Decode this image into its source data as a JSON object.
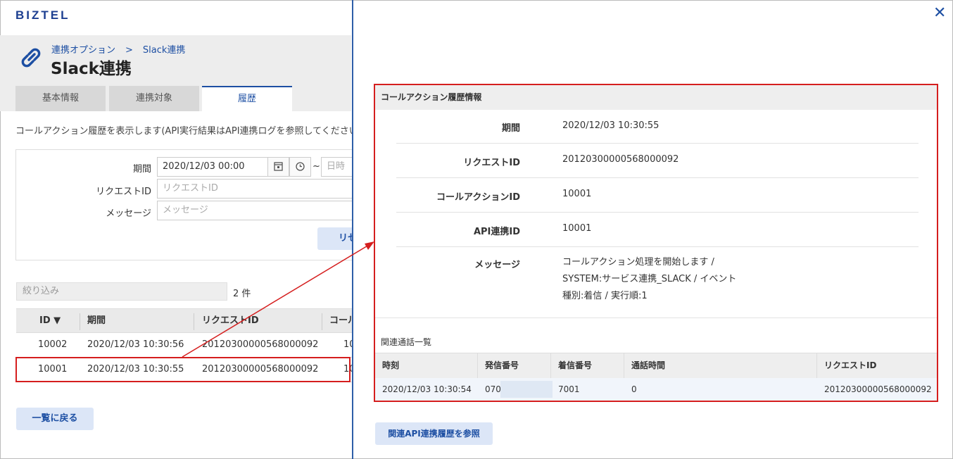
{
  "app": {
    "logo": "BIZTEL"
  },
  "breadcrumb": [
    "連携オプション",
    ">",
    "Slack連携"
  ],
  "page_title": "Slack連携",
  "tabs": [
    {
      "label": "基本情報",
      "active": false
    },
    {
      "label": "連携対象",
      "active": false
    },
    {
      "label": "履歴",
      "active": true
    }
  ],
  "description": "コールアクション履歴を表示します(API実行結果はAPI連携ログを参照してください)",
  "filter": {
    "period_label": "期間",
    "period_from": "2020/12/03 00:00",
    "tilde": "~",
    "period_to_placeholder": "日時",
    "request_id_label": "リクエストID",
    "request_id_placeholder": "リクエストID",
    "message_label": "メッセージ",
    "message_placeholder": "メッセージ",
    "reset_label": "リセ"
  },
  "narrow": {
    "placeholder": "絞り込み",
    "count": "2 件"
  },
  "list_table": {
    "headers": [
      "ID ▼",
      "期間",
      "リクエストID",
      "コール"
    ],
    "rows": [
      [
        "10002",
        "2020/12/03 10:30:56",
        "20120300000568000092",
        "10"
      ],
      [
        "10001",
        "2020/12/03 10:30:55",
        "20120300000568000092",
        "10"
      ]
    ]
  },
  "back_button": "一覧に戻る",
  "detail": {
    "section_title": "コールアクション履歴情報",
    "fields": [
      {
        "key": "期間",
        "value": [
          "2020/12/03 10:30:55"
        ]
      },
      {
        "key": "リクエストID",
        "value": [
          "20120300000568000092"
        ]
      },
      {
        "key": "コールアクションID",
        "value": [
          "10001"
        ]
      },
      {
        "key": "API連携ID",
        "value": [
          "10001"
        ]
      },
      {
        "key": "メッセージ",
        "value": [
          "コールアクション処理を開始します /",
          "SYSTEM:サービス連携_SLACK / イベント",
          "種別:着信 / 実行順:1"
        ]
      }
    ],
    "related_title": "関連通話一覧",
    "related_table": {
      "headers": [
        "時刻",
        "発信番号",
        "着信番号",
        "通話時間",
        "リクエストID"
      ],
      "rows": [
        [
          "2020/12/03 10:30:54",
          "070",
          "7001",
          "0",
          "20120300000568000092"
        ]
      ]
    }
  },
  "api_button": "関連API連携履歴を参照",
  "colors": {
    "accent": "#1d4fa3",
    "highlight": "#d51e1e",
    "divider": "#2e5ea8"
  }
}
